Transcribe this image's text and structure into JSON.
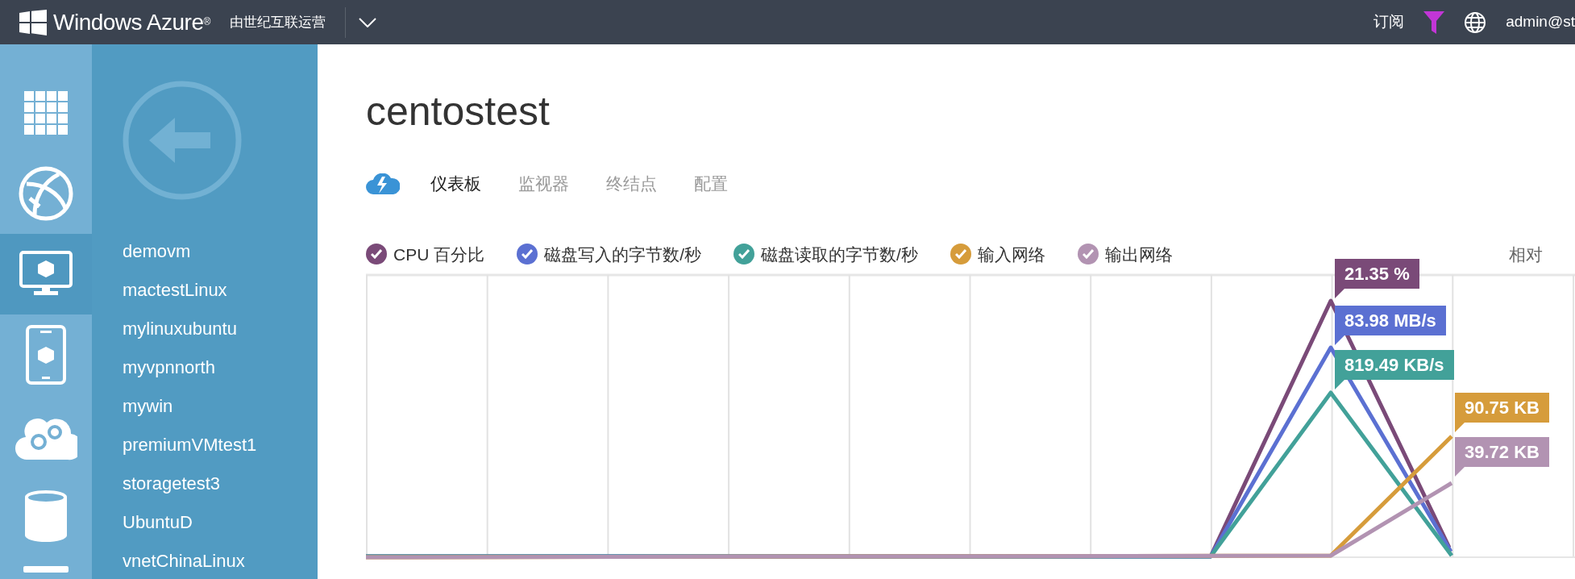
{
  "topbar": {
    "brand": "Windows Azure$^{®}$",
    "operator": "由世纪互联运营",
    "subscriptions": "订阅",
    "user": "admin@st"
  },
  "nav_icons": [
    {
      "kind": "grid",
      "selected": false
    },
    {
      "kind": "globe",
      "selected": false
    },
    {
      "kind": "monitor",
      "selected": true
    },
    {
      "kind": "phone",
      "selected": false
    },
    {
      "kind": "cloud",
      "selected": false
    },
    {
      "kind": "db",
      "selected": false
    },
    {
      "kind": "partial",
      "selected": false
    }
  ],
  "vm_list": [
    "demovm",
    "mactestLinux",
    "mylinuxubuntu",
    "myvpnnorth",
    "mywin",
    "premiumVMtest1",
    "storagetest3",
    "UbuntuD",
    "vnetChinaLinux"
  ],
  "page_title": "centostest",
  "tabs": [
    {
      "label": "仪表板",
      "selected": true
    },
    {
      "label": "监视器",
      "selected": false
    },
    {
      "label": "终结点",
      "selected": false
    },
    {
      "label": "配置",
      "selected": false
    }
  ],
  "legend": [
    {
      "label": "CPU 百分比",
      "checked": true,
      "color": "#7a4a78",
      "callout": "21.35 %"
    },
    {
      "label": "磁盘写入的字节数/秒",
      "checked": true,
      "color": "#5b70d2",
      "callout": "83.98 MB/s"
    },
    {
      "label": "磁盘读取的字节数/秒",
      "checked": true,
      "color": "#42a199",
      "callout": "819.49 KB/s"
    },
    {
      "label": "输入网络",
      "checked": true,
      "color": "#d69c3b",
      "callout": "90.75 KB"
    },
    {
      "label": "输出网络",
      "checked": true,
      "color": "#b293b2",
      "callout": "39.72 KB"
    }
  ],
  "scale_label": "相对"
}
